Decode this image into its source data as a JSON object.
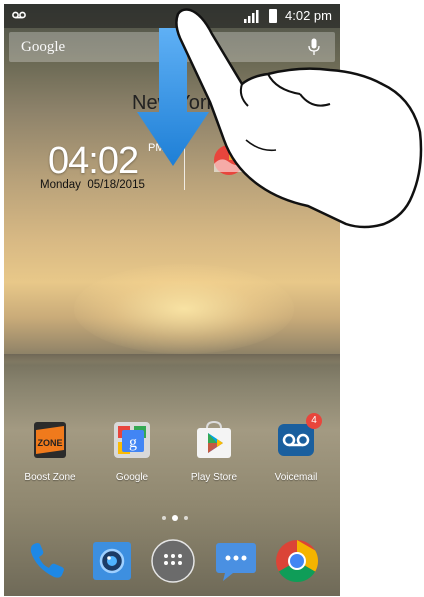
{
  "status_bar": {
    "time": "4:02 pm"
  },
  "search": {
    "label": "Google"
  },
  "clock_widget": {
    "city": "New York",
    "time": "04:02",
    "ampm": "PM",
    "day": "Monday",
    "date": "05/18/2015"
  },
  "apps": [
    {
      "label": "Boost Zone",
      "icon": "boost-zone-icon",
      "tile_text": "ZONE"
    },
    {
      "label": "Google",
      "icon": "google-folder-icon",
      "tile_text": "g"
    },
    {
      "label": "Play Store",
      "icon": "play-store-icon"
    },
    {
      "label": "Voicemail",
      "icon": "voicemail-icon",
      "badge": "4"
    }
  ],
  "dock": [
    {
      "icon": "phone-icon"
    },
    {
      "icon": "camera-icon"
    },
    {
      "icon": "app-drawer-icon"
    },
    {
      "icon": "messaging-icon"
    },
    {
      "icon": "chrome-icon"
    }
  ],
  "colors": {
    "arrow": "#1e7fd6",
    "badge": "#e8453c",
    "boost_orange": "#f07a1c"
  }
}
